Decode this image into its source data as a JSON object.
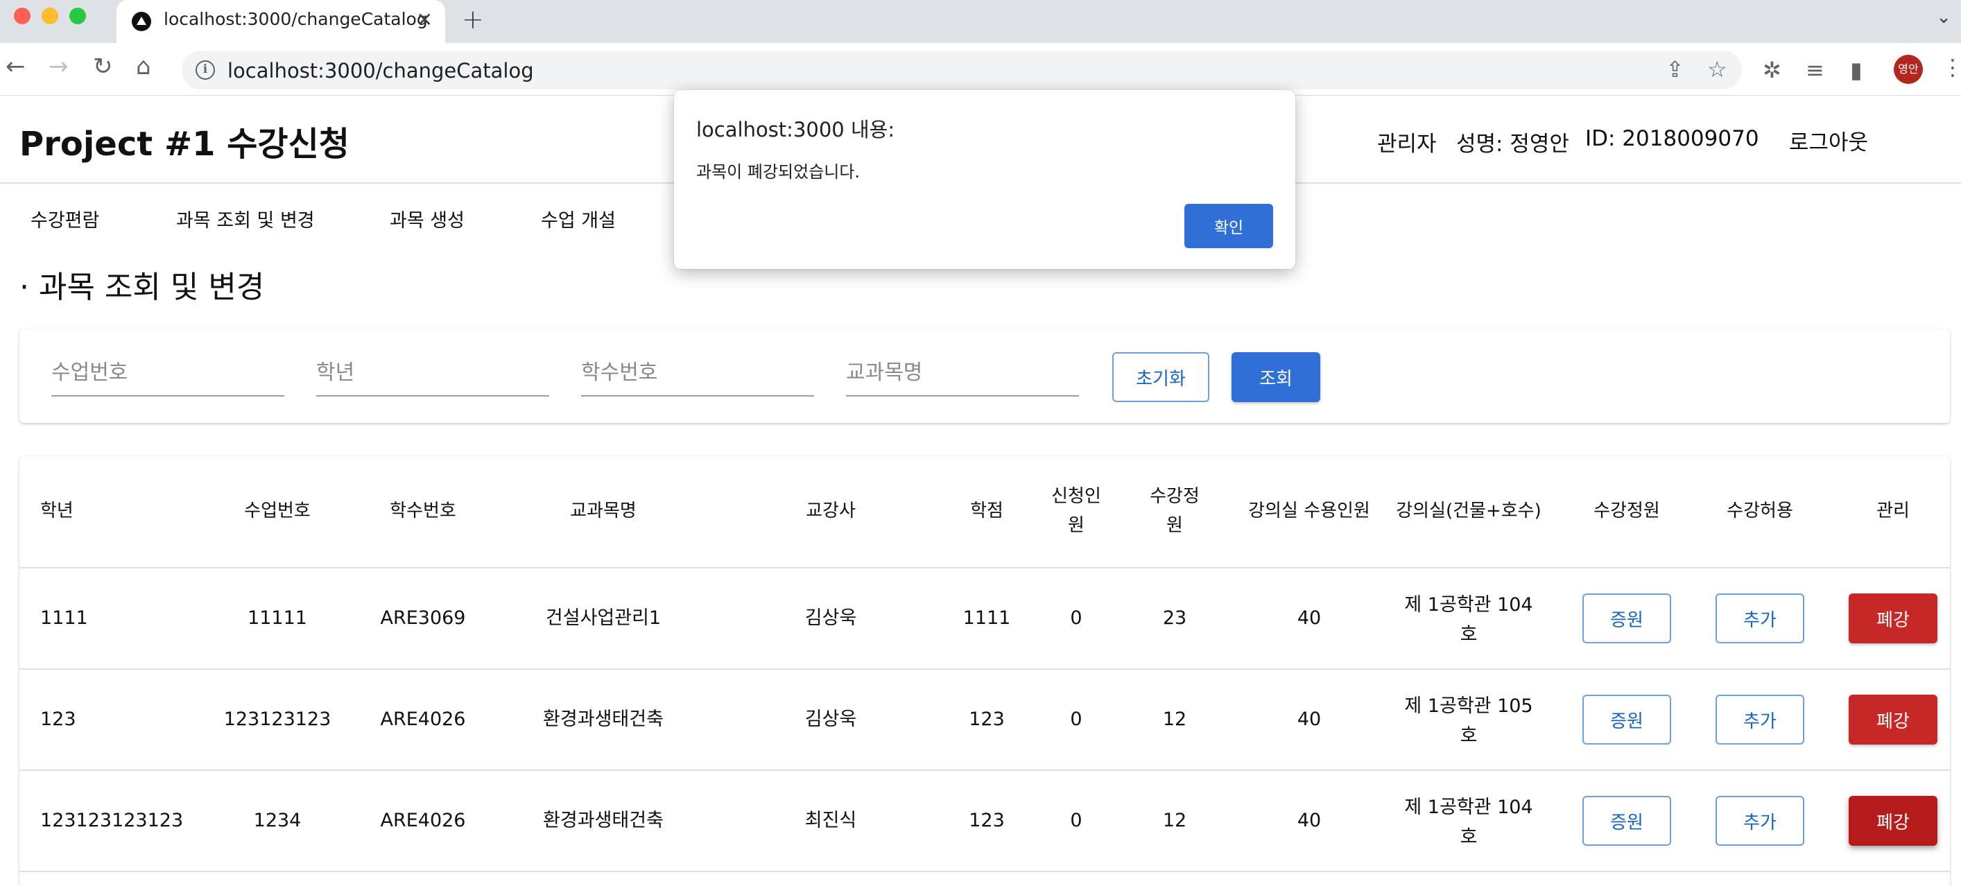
{
  "browser": {
    "tab_title": "localhost:3000/changeCatalog",
    "url": "localhost:3000/changeCatalog",
    "avatar_text": "영안",
    "avatar_color": "#b3261e"
  },
  "header": {
    "app_title": "Project #1 수강신청",
    "role": "관리자",
    "name": "성명: 정영안",
    "user_id": "ID: 2018009070",
    "logout_label": "로그아웃"
  },
  "menu": {
    "items": [
      {
        "label": "수강편람"
      },
      {
        "label": "과목 조회 및 변경"
      },
      {
        "label": "과목 생성"
      },
      {
        "label": "수업 개설"
      }
    ]
  },
  "page": {
    "section_title": "· 과목 조회 및 변경"
  },
  "search": {
    "class_no_placeholder": "수업번호",
    "year_placeholder": "학년",
    "course_no_placeholder": "학수번호",
    "course_name_placeholder": "교과목명",
    "reset_label": "초기화",
    "search_label": "조회"
  },
  "table": {
    "headers": [
      "학년",
      "수업번호",
      "학수번호",
      "교과목명",
      "교강사",
      "학점",
      "신청인원",
      "수강정원",
      "강의실 수용인원",
      "강의실(건물+호수)",
      "수강정원",
      "수강허용",
      "관리"
    ],
    "rows": [
      {
        "year": "1111",
        "class_no": "11111",
        "course_no": "ARE3069",
        "name": "건설사업관리1",
        "instructor": "김상욱",
        "credit": "1111",
        "applied": "0",
        "capacity": "23",
        "room_capacity": "40",
        "room": "제 1공학관 104호",
        "increase_label": "증원",
        "allow_label": "추가",
        "close_label": "폐강"
      },
      {
        "year": "123",
        "class_no": "123123123",
        "course_no": "ARE4026",
        "name": "환경과생태건축",
        "instructor": "김상욱",
        "credit": "123",
        "applied": "0",
        "capacity": "12",
        "room_capacity": "40",
        "room": "제 1공학관 105호",
        "increase_label": "증원",
        "allow_label": "추가",
        "close_label": "폐강"
      },
      {
        "year": "123123123123",
        "class_no": "1234",
        "course_no": "ARE4026",
        "name": "환경과생태건축",
        "instructor": "최진식",
        "credit": "123",
        "applied": "0",
        "capacity": "12",
        "room_capacity": "40",
        "room": "제 1공학관 104호",
        "increase_label": "증원",
        "allow_label": "추가",
        "close_label": "폐강"
      }
    ]
  },
  "dialog": {
    "title": "localhost:3000 내용:",
    "message": "과목이 폐강되었습니다.",
    "ok_label": "확인"
  },
  "colors": {
    "primary": "#2f6fd6",
    "danger": "#c62828",
    "outline": "#1565c0"
  }
}
